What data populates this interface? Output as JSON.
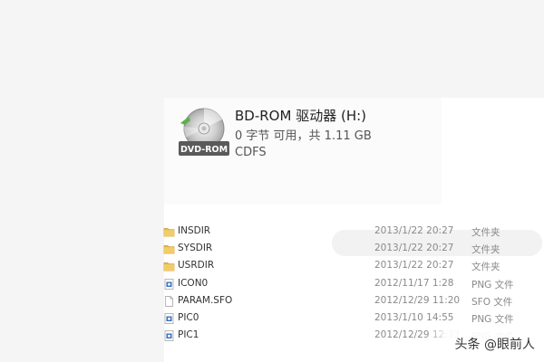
{
  "drive": {
    "name": "BD-ROM 驱动器 (H:)",
    "space": "0 字节 可用，共 1.11 GB",
    "filesystem": "CDFS",
    "icon_label": "DVD-ROM",
    "icon": "dvd-rom-drive-icon"
  },
  "files": [
    {
      "name": "INSDIR",
      "date": "2013/1/22 20:27",
      "type": "文件夹",
      "icon": "folder-icon"
    },
    {
      "name": "SYSDIR",
      "date": "2013/1/22 20:27",
      "type": "文件夹",
      "icon": "folder-icon"
    },
    {
      "name": "USRDIR",
      "date": "2013/1/22 20:27",
      "type": "文件夹",
      "icon": "folder-icon"
    },
    {
      "name": "ICON0",
      "date": "2012/11/17 1:28",
      "type": "PNG 文件",
      "icon": "image-file-icon"
    },
    {
      "name": "PARAM.SFO",
      "date": "2012/12/29 11:20",
      "type": "SFO 文件",
      "icon": "generic-file-icon"
    },
    {
      "name": "PIC0",
      "date": "2013/1/10 14:55",
      "type": "PNG 文件",
      "icon": "image-file-icon"
    },
    {
      "name": "PIC1",
      "date": "2012/12/29 12:33",
      "type": "PNG 文件",
      "icon": "image-file-icon"
    }
  ],
  "watermark": "头条 @眼前人",
  "colors": {
    "folder": "#e8b94a",
    "image_icon": "#3a72c4",
    "secondary_text": "#8a8a8a"
  }
}
